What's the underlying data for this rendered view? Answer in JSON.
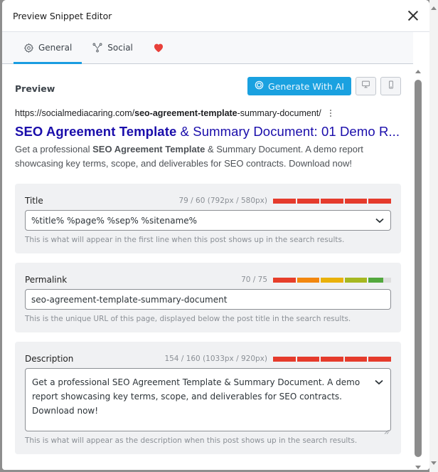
{
  "modal": {
    "title": "Preview Snippet Editor",
    "close_label": "Close"
  },
  "tabs": [
    {
      "label": "General",
      "icon": "gear-icon",
      "active": true
    },
    {
      "label": "Social",
      "icon": "share-nodes-icon",
      "active": false
    },
    {
      "label": "",
      "icon": "heart-icon",
      "active": false,
      "color": "#e8403a"
    }
  ],
  "preview": {
    "label": "Preview",
    "generate_ai_label": "Generate With AI",
    "desktop_label": "Desktop preview",
    "mobile_label": "Mobile preview"
  },
  "serp": {
    "url_prefix": "https://socialmediacaring.com/",
    "url_bold": "seo-agreement-template",
    "url_suffix": "-summary-document/",
    "title_bold": "SEO Agreement Template",
    "title_rest": " & Summary Document: 01 Demo R...",
    "desc_prefix": "Get a professional ",
    "desc_bold": "SEO Agreement Template",
    "desc_rest": " & Summary Document. A demo report showcasing key terms, scope, and deliverables for SEO contracts. Download now!"
  },
  "fields": {
    "title": {
      "label": "Title",
      "counter": "79 / 60 (792px / 580px)",
      "value": "%title% %page% %sep% %sitename%",
      "hint": "This is what will appear in the first line when this post shows up in the search results.",
      "progress": 1.0,
      "segments": [
        "#e53b2c",
        "#e53b2c",
        "#e53b2c",
        "#e53b2c",
        "#e53b2c"
      ]
    },
    "permalink": {
      "label": "Permalink",
      "counter": "70 / 75",
      "value": "seo-agreement-template-summary-document",
      "hint": "This is the unique URL of this page, displayed below the post title in the search results.",
      "progress": 0.93,
      "segments": [
        "#e63e2a",
        "#f2870f",
        "#e9b10a",
        "#a6b820",
        "#53a83d"
      ],
      "empty_color": "#dedede"
    },
    "description": {
      "label": "Description",
      "counter": "154 / 160 (1033px / 920px)",
      "value": "Get a professional SEO Agreement Template & Summary Document. A demo report showcasing key terms, scope, and deliverables for SEO contracts. Download now!",
      "hint": "This is what will appear as the description when this post shows up in the search results.",
      "progress": 1.0,
      "segments": [
        "#e53b2c",
        "#e53b2c",
        "#e53b2c",
        "#e53b2c",
        "#e53b2c"
      ]
    }
  },
  "colors": {
    "accent": "#1aa1e0",
    "serp_title": "#1a0dab",
    "danger": "#e53b2c"
  }
}
